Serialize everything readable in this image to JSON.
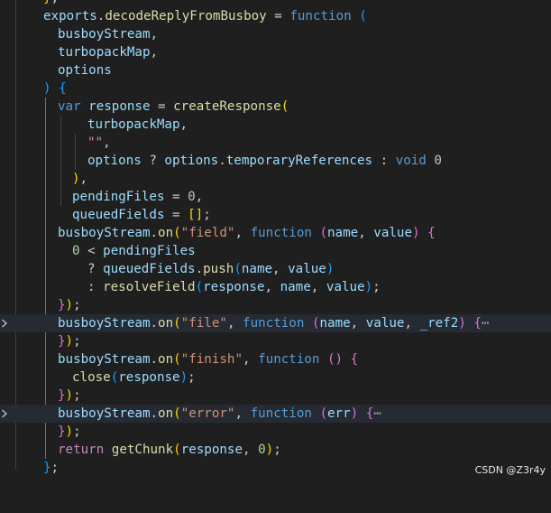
{
  "colors": {
    "background": "#1f1f1f",
    "highlight_line": "#262a33",
    "variable": "#9cdcfe",
    "keyword": "#569cd6",
    "function": "#dcdcaa",
    "string": "#ce9178",
    "number": "#b5cea8",
    "bracket_yellow": "#ffd700",
    "bracket_purple": "#da70d6",
    "bracket_blue": "#179fff"
  },
  "code": {
    "l0": {
      "brace": "}",
      "semi": ";"
    },
    "l1": {
      "exports": "exports",
      "dot": ".",
      "name": "decodeReplyFromBusboy",
      "eq": " = ",
      "kw": "function",
      "sp": " ",
      "paren": "("
    },
    "l2": {
      "param": "busboyStream",
      "comma": ","
    },
    "l3": {
      "param": "turbopackMap",
      "comma": ","
    },
    "l4": {
      "param": "options"
    },
    "l5": {
      "paren": ")",
      "sp": " ",
      "brace": "{"
    },
    "l6": {
      "kw": "var",
      "sp": " ",
      "name": "response",
      "eq": " = ",
      "fn": "createResponse",
      "paren": "("
    },
    "l7": {
      "arg": "turbopackMap",
      "comma": ","
    },
    "l8": {
      "str": "\"\"",
      "comma": ","
    },
    "l9": {
      "a": "options",
      "q": " ? ",
      "b": "options",
      "dot": ".",
      "c": "temporaryReferences",
      "colon": " : ",
      "kw": "void",
      "sp": " ",
      "num": "0"
    },
    "l10": {
      "paren": ")",
      "comma": ","
    },
    "l11": {
      "name": "pendingFiles",
      "eq": " = ",
      "num": "0",
      "comma": ","
    },
    "l12": {
      "name": "queuedFields",
      "eq": " = ",
      "arr": "[]",
      "semi": ";"
    },
    "l13": {
      "obj": "busboyStream",
      "dot": ".",
      "fn": "on",
      "p1": "(",
      "str": "\"field\"",
      "comma": ", ",
      "kw": "function",
      "sp": " ",
      "p2": "(",
      "a": "name",
      "c2": ", ",
      "b": "value",
      "p3": ")",
      "sp2": " ",
      "brace": "{"
    },
    "l14": {
      "num": "0",
      "lt": " < ",
      "name": "pendingFiles"
    },
    "l15": {
      "q": "? ",
      "obj": "queuedFields",
      "dot": ".",
      "fn": "push",
      "p1": "(",
      "a": "name",
      "c": ", ",
      "b": "value",
      "p2": ")"
    },
    "l16": {
      "colon": ": ",
      "fn": "resolveField",
      "p1": "(",
      "a": "response",
      "c1": ", ",
      "b": "name",
      "c2": ", ",
      "c": "value",
      "p2": ")",
      "semi": ";"
    },
    "l17": {
      "brace": "}",
      "paren": ")",
      "semi": ";"
    },
    "l18": {
      "obj": "busboyStream",
      "dot": ".",
      "fn": "on",
      "p1": "(",
      "str": "\"file\"",
      "comma": ", ",
      "kw": "function",
      "sp": " ",
      "p2": "(",
      "a": "name",
      "c1": ", ",
      "b": "value",
      "c2": ", ",
      "c": "_ref2",
      "p3": ")",
      "sp2": " ",
      "brace": "{",
      "ellipsis": "⋯"
    },
    "l19": {
      "brace": "}",
      "paren": ")",
      "semi": ";"
    },
    "l20": {
      "obj": "busboyStream",
      "dot": ".",
      "fn": "on",
      "p1": "(",
      "str": "\"finish\"",
      "comma": ", ",
      "kw": "function",
      "sp": " ",
      "p2": "()",
      "sp2": " ",
      "brace": "{"
    },
    "l21": {
      "fn": "close",
      "p1": "(",
      "a": "response",
      "p2": ")",
      "semi": ";"
    },
    "l22": {
      "brace": "}",
      "paren": ")",
      "semi": ";"
    },
    "l23": {
      "obj": "busboyStream",
      "dot": ".",
      "fn": "on",
      "p1": "(",
      "str": "\"error\"",
      "comma": ", ",
      "kw": "function",
      "sp": " ",
      "p2": "(",
      "a": "err",
      "p3": ")",
      "sp2": " ",
      "brace": "{",
      "ellipsis": "⋯"
    },
    "l24": {
      "brace": "}",
      "paren": ")",
      "semi": ";"
    },
    "l25": {
      "kw": "return",
      "sp": " ",
      "fn": "getChunk",
      "p1": "(",
      "a": "response",
      "c": ", ",
      "num": "0",
      "p2": ")",
      "semi": ";"
    },
    "l26": {
      "brace": "}",
      "semi": ";"
    }
  },
  "fold_icon": "chevron-right-icon",
  "watermark": "CSDN @Z3r4y"
}
